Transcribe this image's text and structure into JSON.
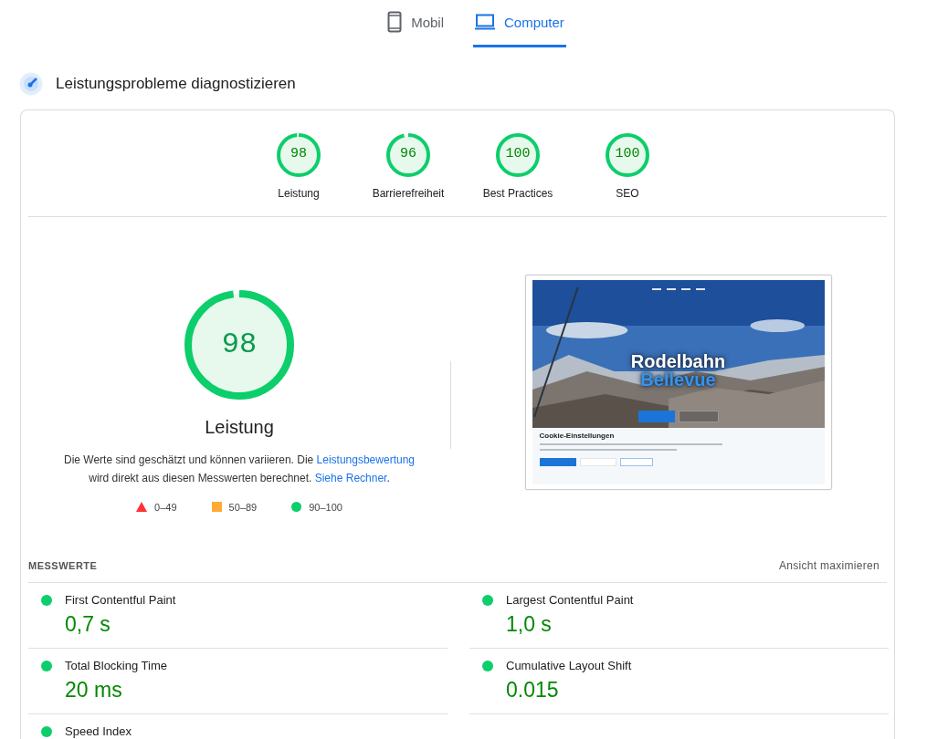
{
  "tabs": [
    {
      "label": "Mobil",
      "kind": "phone",
      "selected": false
    },
    {
      "label": "Computer",
      "kind": "desktop",
      "selected": true
    }
  ],
  "section_title": "Leistungsprobleme diagnostizieren",
  "scores": [
    {
      "value": "98",
      "label": "Leistung",
      "level": 0.98
    },
    {
      "value": "96",
      "label": "Barrierefreiheit",
      "level": 0.96
    },
    {
      "value": "100",
      "label": "Best Practices",
      "level": 1
    },
    {
      "value": "100",
      "label": "SEO",
      "level": 1
    }
  ],
  "main_score": {
    "value": "98",
    "label": "Leistung",
    "level": 0.98
  },
  "note": {
    "text_1": "Die Werte sind geschätzt und können variieren. Die ",
    "link_1": "Leistungsbewertung",
    "text_2": " wird direkt aus diesen Messwerten berechnet. ",
    "link_2": "Siehe Rechner",
    "text_3": "."
  },
  "legend": [
    {
      "kind": "triangle",
      "label": "0–49",
      "color": "#ff3333"
    },
    {
      "kind": "square",
      "label": "50–89",
      "color": "#ffaa33"
    },
    {
      "kind": "circle",
      "label": "90–100",
      "color": "#0cce6b"
    }
  ],
  "screenshot": {
    "title_1": "Rodelbahn",
    "title_2": "Bellevue",
    "cookie_title": "Cookie-Einstellungen"
  },
  "metrics_heading": "MESSWERTE",
  "expand_link": "Ansicht maximieren",
  "metrics": [
    {
      "name": "First Contentful Paint",
      "value": "0,7 s",
      "color": "#0cce6b"
    },
    {
      "name": "Largest Contentful Paint",
      "value": "1,0 s",
      "color": "#0cce6b"
    },
    {
      "name": "Total Blocking Time",
      "value": "20 ms",
      "color": "#0cce6b"
    },
    {
      "name": "Cumulative Layout Shift",
      "value": "0.015",
      "color": "#0cce6b"
    },
    {
      "name": "Speed Index",
      "color": "#0cce6b"
    }
  ]
}
